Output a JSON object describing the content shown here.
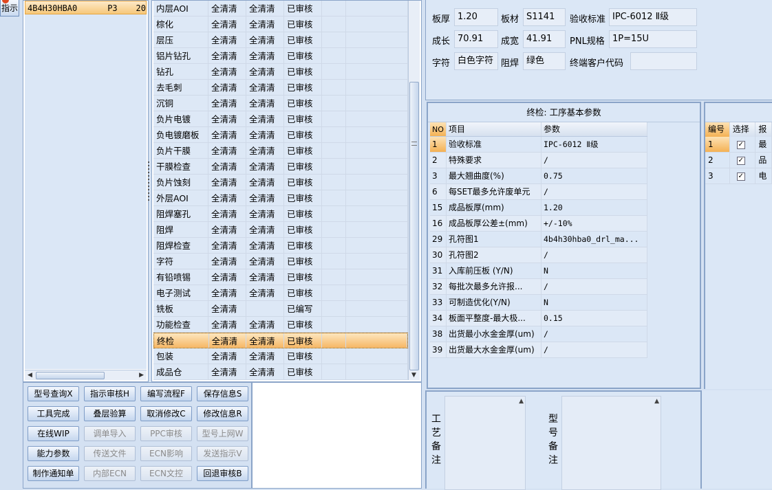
{
  "guide_button": {
    "label": "指示"
  },
  "model_list": {
    "selected_row": {
      "model": "4B4H30HBA0",
      "code": "P3",
      "count": "20"
    }
  },
  "process_rows": [
    {
      "name": "内层AOI",
      "a": "全清清",
      "b": "全清清",
      "status": "已审核"
    },
    {
      "name": "棕化",
      "a": "全清清",
      "b": "全清清",
      "status": "已审核"
    },
    {
      "name": "层压",
      "a": "全清清",
      "b": "全清清",
      "status": "已审核"
    },
    {
      "name": "铝片钻孔",
      "a": "全清清",
      "b": "全清清",
      "status": "已审核"
    },
    {
      "name": "钻孔",
      "a": "全清清",
      "b": "全清清",
      "status": "已审核"
    },
    {
      "name": "去毛刺",
      "a": "全清清",
      "b": "全清清",
      "status": "已审核"
    },
    {
      "name": "沉铜",
      "a": "全清清",
      "b": "全清清",
      "status": "已审核"
    },
    {
      "name": "负片电镀",
      "a": "全清清",
      "b": "全清清",
      "status": "已审核"
    },
    {
      "name": "负电镀磨板",
      "a": "全清清",
      "b": "全清清",
      "status": "已审核"
    },
    {
      "name": "负片干膜",
      "a": "全清清",
      "b": "全清清",
      "status": "已审核"
    },
    {
      "name": "干膜检查",
      "a": "全清清",
      "b": "全清清",
      "status": "已审核"
    },
    {
      "name": "负片蚀刻",
      "a": "全清清",
      "b": "全清清",
      "status": "已审核"
    },
    {
      "name": "外层AOI",
      "a": "全清清",
      "b": "全清清",
      "status": "已审核"
    },
    {
      "name": "阻焊塞孔",
      "a": "全清清",
      "b": "全清清",
      "status": "已审核"
    },
    {
      "name": "阻焊",
      "a": "全清清",
      "b": "全清清",
      "status": "已审核"
    },
    {
      "name": "阻焊检查",
      "a": "全清清",
      "b": "全清清",
      "status": "已审核"
    },
    {
      "name": "字符",
      "a": "全清清",
      "b": "全清清",
      "status": "已审核"
    },
    {
      "name": "有铅喷锡",
      "a": "全清清",
      "b": "全清清",
      "status": "已审核"
    },
    {
      "name": "电子测试",
      "a": "全清清",
      "b": "全清清",
      "status": "已审核"
    },
    {
      "name": "铣板",
      "a": "全清清",
      "b": "",
      "status": "已编写"
    },
    {
      "name": "功能检查",
      "a": "全清清",
      "b": "全清清",
      "status": "已审核"
    },
    {
      "name": "终检",
      "a": "全清清",
      "b": "全清清",
      "status": "已审核",
      "selected": true
    },
    {
      "name": "包装",
      "a": "全清清",
      "b": "全清清",
      "status": "已审核"
    },
    {
      "name": "成品仓",
      "a": "全清清",
      "b": "全清清",
      "status": "已审核"
    }
  ],
  "toolbar_buttons": [
    {
      "label": "型号查询X",
      "enabled": true
    },
    {
      "label": "指示审核H",
      "enabled": true
    },
    {
      "label": "编写流程F",
      "enabled": true
    },
    {
      "label": "保存信息S",
      "enabled": true
    },
    {
      "label": "工具完成",
      "enabled": true
    },
    {
      "label": "叠层验算",
      "enabled": true
    },
    {
      "label": "取消修改C",
      "enabled": true
    },
    {
      "label": "修改信息R",
      "enabled": true
    },
    {
      "label": "在线WIP",
      "enabled": true
    },
    {
      "label": "调单导入",
      "enabled": false
    },
    {
      "label": "PPC审核",
      "enabled": false
    },
    {
      "label": "型号上网W",
      "enabled": false
    },
    {
      "label": "能力参数",
      "enabled": true
    },
    {
      "label": "传送文件",
      "enabled": false
    },
    {
      "label": "ECN影响",
      "enabled": false
    },
    {
      "label": "发送指示V",
      "enabled": false
    },
    {
      "label": "制作通知单",
      "enabled": true
    },
    {
      "label": "内部ECN",
      "enabled": false
    },
    {
      "label": "ECN文控",
      "enabled": false
    },
    {
      "label": "回退审核B",
      "enabled": true
    }
  ],
  "info": {
    "board_thickness_label": "板厚",
    "board_thickness": "1.20",
    "material_label": "板材",
    "material": "S1141",
    "acceptance_label": "验收标准",
    "acceptance": "IPC-6012 Ⅱ级",
    "length_label": "成长",
    "length": "70.91",
    "width_label": "成宽",
    "width": "41.91",
    "pnl_label": "PNL规格",
    "pnl": "1P=15U",
    "char_label": "字符",
    "char": "白色字符",
    "mask_label": "阻焊",
    "mask": "绿色",
    "customer_code_label": "终端客户代码",
    "customer_code": ""
  },
  "params": {
    "title": "终检: 工序基本参数",
    "headers": {
      "no": "NO",
      "item": "项目",
      "value": "参数"
    },
    "rows": [
      {
        "no": "1",
        "item": "验收标准",
        "value": "IPC-6012 Ⅱ级",
        "selected": true
      },
      {
        "no": "2",
        "item": "特殊要求",
        "value": "/"
      },
      {
        "no": "3",
        "item": "最大翘曲度(%)",
        "value": "0.75"
      },
      {
        "no": "6",
        "item": "每SET最多允许废单元",
        "value": "/"
      },
      {
        "no": "15",
        "item": "成品板厚(mm)",
        "value": "1.20"
      },
      {
        "no": "16",
        "item": "成品板厚公差±(mm)",
        "value": "+/-10%"
      },
      {
        "no": "29",
        "item": "孔符图1",
        "value": "4b4h30hba0_drl_ma..."
      },
      {
        "no": "30",
        "item": "孔符图2",
        "value": "/"
      },
      {
        "no": "31",
        "item": "入库前压板 (Y/N)",
        "value": "N"
      },
      {
        "no": "32",
        "item": "每批次最多允许报...",
        "value": "/"
      },
      {
        "no": "33",
        "item": "可制造优化(Y/N)",
        "value": "N"
      },
      {
        "no": "34",
        "item": "板面平整度-最大极...",
        "value": "0.15"
      },
      {
        "no": "38",
        "item": "出货最小水金金厚(um)",
        "value": "/"
      },
      {
        "no": "39",
        "item": "出货最大水金金厚(um)",
        "value": "/"
      }
    ]
  },
  "select_table": {
    "headers": {
      "num": "编号",
      "select": "选择",
      "more": "报"
    },
    "rows": [
      {
        "num": "1",
        "checked": true,
        "text": "最",
        "selected": true
      },
      {
        "num": "2",
        "checked": true,
        "text": "品"
      },
      {
        "num": "3",
        "checked": true,
        "text": "电"
      }
    ]
  },
  "notes": {
    "process_label": "工艺备注",
    "model_label": "型号备注"
  },
  "colors": {
    "accent": "#f6b765",
    "panel": "#dbe7f6",
    "border": "#8aa4c8"
  }
}
